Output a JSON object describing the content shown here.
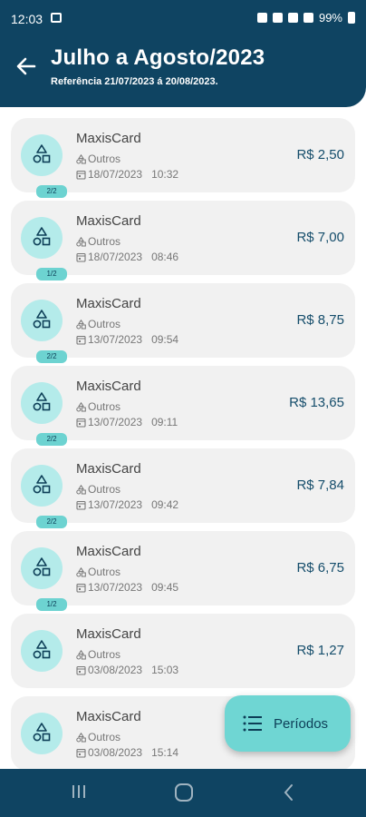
{
  "status_bar": {
    "time": "12:03",
    "battery": "99%"
  },
  "header": {
    "title": "Julho a Agosto/2023",
    "subtitle": "Referência 21/07/2023 á 20/08/2023."
  },
  "transactions": [
    {
      "merchant": "MaxisCard",
      "category": "Outros",
      "date": "18/07/2023",
      "time": "10:32",
      "amount": "R$ 2,50",
      "installment": "2/2"
    },
    {
      "merchant": "MaxisCard",
      "category": "Outros",
      "date": "18/07/2023",
      "time": "08:46",
      "amount": "R$ 7,00",
      "installment": "1/2"
    },
    {
      "merchant": "MaxisCard",
      "category": "Outros",
      "date": "13/07/2023",
      "time": "09:54",
      "amount": "R$ 8,75",
      "installment": "2/2"
    },
    {
      "merchant": "MaxisCard",
      "category": "Outros",
      "date": "13/07/2023",
      "time": "09:11",
      "amount": "R$ 13,65",
      "installment": "2/2"
    },
    {
      "merchant": "MaxisCard",
      "category": "Outros",
      "date": "13/07/2023",
      "time": "09:42",
      "amount": "R$ 7,84",
      "installment": "2/2"
    },
    {
      "merchant": "MaxisCard",
      "category": "Outros",
      "date": "13/07/2023",
      "time": "09:45",
      "amount": "R$ 6,75",
      "installment": "1/2"
    },
    {
      "merchant": "MaxisCard",
      "category": "Outros",
      "date": "03/08/2023",
      "time": "15:03",
      "amount": "R$ 1,27",
      "installment": ""
    },
    {
      "merchant": "MaxisCard",
      "category": "Outros",
      "date": "03/08/2023",
      "time": "15:14",
      "amount": "",
      "installment": ""
    }
  ],
  "fab": {
    "label": "Períodos",
    "icon": "list-icon"
  },
  "colors": {
    "primary": "#0f4462",
    "accent": "#6fd6d3",
    "avatar_bg": "#b4ebea",
    "card_bg": "#f1f1f1"
  }
}
